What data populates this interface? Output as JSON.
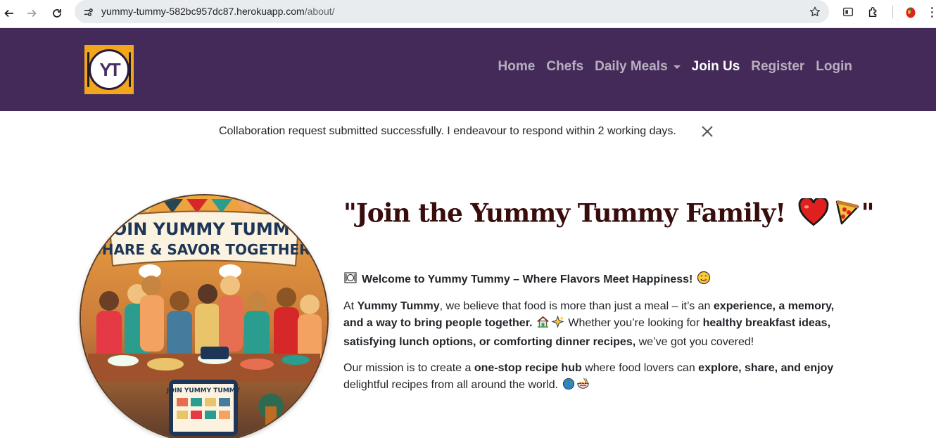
{
  "browser": {
    "url_host": "yummy-tummy-582bc957dc87.herokuapp.com",
    "url_path": "/about/",
    "icons": [
      "back-arrow",
      "forward-arrow",
      "reload",
      "site-info",
      "bookmark-star",
      "cast",
      "extensions",
      "profile-avatar",
      "more-menu"
    ]
  },
  "navbar": {
    "logo_text": "YT",
    "links": [
      {
        "label": "Home",
        "active": false
      },
      {
        "label": "Chefs",
        "active": false
      },
      {
        "label": "Daily Meals",
        "active": false,
        "dropdown": true
      },
      {
        "label": "Join Us",
        "active": true
      },
      {
        "label": "Register",
        "active": false
      },
      {
        "label": "Login",
        "active": false
      }
    ]
  },
  "alert": {
    "message": "Collaboration request submitted successfully. I endeavour to respond within 2 working days."
  },
  "hero_image": {
    "banner_line1": "JOIN YUMMY TUMMY",
    "banner_line2": "SHARE & SAVOR TOGETHER!",
    "tablet_text": "JOIN YUMMY TUMMY"
  },
  "content": {
    "headline": "\"Join the Yummy Tummy Family!",
    "headline_close": "\"",
    "welcome": "Welcome to Yummy Tummy – Where Flavors Meet Happiness!",
    "p1": {
      "t1": "At ",
      "b1": "Yummy Tummy",
      "t2": ", we believe that food is more than just a meal – it’s an ",
      "b2": "experience, a memory, and a way to bring people together.",
      "t3": " Whether you’re looking for ",
      "b3": "healthy breakfast ideas, satisfying lunch options, or comforting dinner recipes,",
      "t4": " we’ve got you covered!"
    },
    "p2": {
      "t1": "Our mission is to create a ",
      "b1": "one-stop recipe hub",
      "t2": " where food lovers can ",
      "b2": "explore, share, and enjoy",
      "t3": " delightful recipes from all around the world."
    }
  },
  "colors": {
    "navbar_bg": "#432a58",
    "logo_bg": "#f2a61b",
    "headline": "#3a0d0d"
  }
}
